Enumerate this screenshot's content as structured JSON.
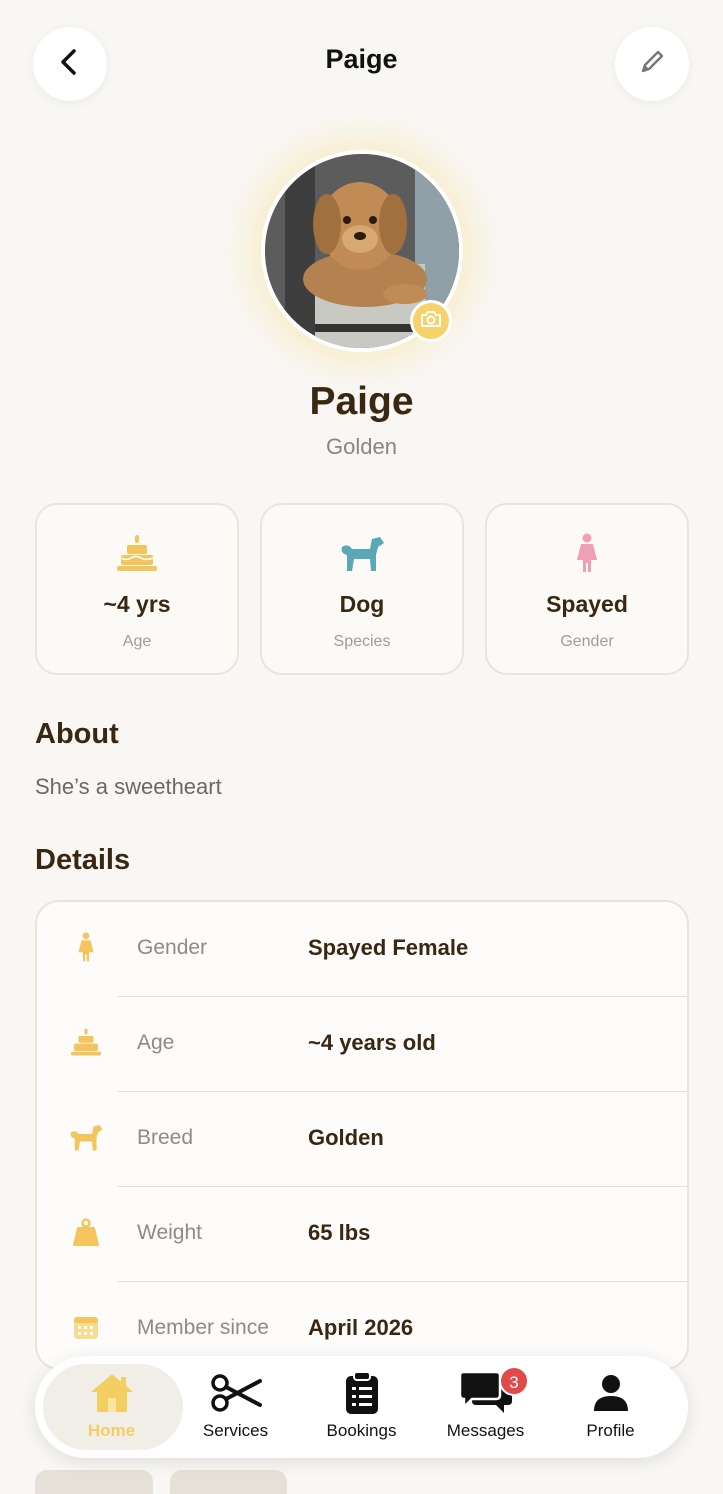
{
  "header": {
    "title": "Paige"
  },
  "profile": {
    "name": "Paige",
    "breed": "Golden"
  },
  "stats": [
    {
      "icon": "cake-icon",
      "value": "~4 yrs",
      "label": "Age"
    },
    {
      "icon": "dog-icon",
      "value": "Dog",
      "label": "Species"
    },
    {
      "icon": "female-icon",
      "value": "Spayed",
      "label": "Gender"
    }
  ],
  "about": {
    "title": "About",
    "text": "She’s a sweetheart"
  },
  "details": {
    "title": "Details",
    "rows": [
      {
        "icon": "female-icon",
        "label": "Gender",
        "value": "Spayed Female"
      },
      {
        "icon": "cake-icon",
        "label": "Age",
        "value": "~4 years old"
      },
      {
        "icon": "dog-icon",
        "label": "Breed",
        "value": "Golden"
      },
      {
        "icon": "weight-icon",
        "label": "Weight",
        "value": "65 lbs"
      },
      {
        "icon": "calendar-icon",
        "label": "Member since",
        "value": "April 2026"
      }
    ]
  },
  "tabbar": {
    "active": "Home",
    "tabs": [
      {
        "icon": "home-icon",
        "label": "Home"
      },
      {
        "icon": "scissors-icon",
        "label": "Services"
      },
      {
        "icon": "clipboard-icon",
        "label": "Bookings"
      },
      {
        "icon": "chat-icon",
        "label": "Messages",
        "badge": "3"
      },
      {
        "icon": "person-icon",
        "label": "Profile"
      }
    ]
  },
  "colors": {
    "accent": "#f3cf63",
    "dog_icon": "#5aa7b5",
    "female_icon": "#ef9fb6",
    "badge": "#e24a4a",
    "text_dark": "#3a2712"
  }
}
